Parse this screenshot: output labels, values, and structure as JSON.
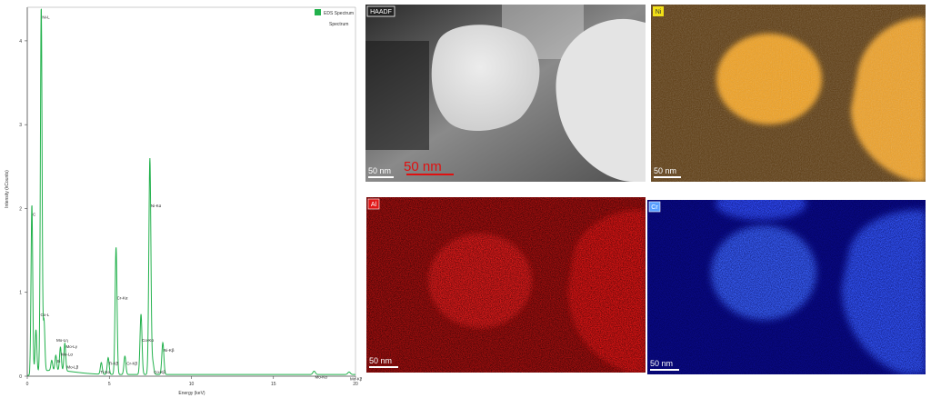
{
  "chart_data": {
    "type": "line",
    "title": "",
    "xlabel": "Energy (keV)",
    "ylabel": "Intensity (kCounts)",
    "xlim": [
      0,
      20
    ],
    "ylim": [
      0,
      4.4
    ],
    "x_ticks": [
      "0",
      "5",
      "10",
      "15",
      "20"
    ],
    "y_ticks": [
      "0",
      "1",
      "2",
      "3",
      "4"
    ],
    "grid": false,
    "legend_position": "top-right",
    "legend": [
      "EDS Spectrum",
      "Spectrum"
    ],
    "series": [
      {
        "name": "EDS Spectrum",
        "color": "#22b14c",
        "peaks": [
          {
            "x": 0.28,
            "y": 2.0
          },
          {
            "x": 0.53,
            "y": 0.5
          },
          {
            "x": 0.85,
            "y": 4.35
          },
          {
            "x": 1.02,
            "y": 0.6
          },
          {
            "x": 1.49,
            "y": 0.12
          },
          {
            "x": 1.74,
            "y": 0.18
          },
          {
            "x": 2.02,
            "y": 0.28
          },
          {
            "x": 2.29,
            "y": 0.33
          },
          {
            "x": 4.51,
            "y": 0.14
          },
          {
            "x": 4.93,
            "y": 0.2
          },
          {
            "x": 5.41,
            "y": 1.52
          },
          {
            "x": 5.95,
            "y": 0.22
          },
          {
            "x": 6.93,
            "y": 0.72
          },
          {
            "x": 7.47,
            "y": 2.58
          },
          {
            "x": 7.65,
            "y": 0.14
          },
          {
            "x": 8.26,
            "y": 0.38
          },
          {
            "x": 17.48,
            "y": 0.04
          },
          {
            "x": 19.61,
            "y": 0.03
          }
        ]
      }
    ],
    "annotations": [
      {
        "text": "Ni-L",
        "x": 0.85,
        "y": 4.35
      },
      {
        "text": "C",
        "x": 0.28,
        "y": 2.0
      },
      {
        "text": "Co-L",
        "x": 0.75,
        "y": 0.8
      },
      {
        "text": "Mo-Lη",
        "x": 1.72,
        "y": 0.5
      },
      {
        "text": "Mo-Lγ",
        "x": 2.3,
        "y": 0.42
      },
      {
        "text": "Mo-Lα",
        "x": 2.0,
        "y": 0.33
      },
      {
        "text": "Mo-Lβ",
        "x": 2.35,
        "y": 0.18
      },
      {
        "text": "Si",
        "x": 1.74,
        "y": 0.25
      },
      {
        "text": "Ti-Kβ",
        "x": 4.9,
        "y": 0.22
      },
      {
        "text": "Ti-Kα",
        "x": 4.4,
        "y": 0.12
      },
      {
        "text": "Cr-Kα",
        "x": 5.41,
        "y": 1.0
      },
      {
        "text": "Cr-Kβ",
        "x": 6.0,
        "y": 0.22
      },
      {
        "text": "Ni-Kα",
        "x": 7.47,
        "y": 2.1
      },
      {
        "text": "Co-Kα",
        "x": 6.93,
        "y": 0.5
      },
      {
        "text": "Co-Kβ",
        "x": 7.65,
        "y": 0.12
      },
      {
        "text": "Ni-Kβ",
        "x": 8.26,
        "y": 0.38
      },
      {
        "text": "Mo-Kα",
        "x": 17.48,
        "y": 0.06
      },
      {
        "text": "Mo-Kβ",
        "x": 19.61,
        "y": 0.04
      }
    ]
  },
  "images": {
    "haadf": {
      "label": "HAADF",
      "scale": "50 nm",
      "overlay": "50 nm"
    },
    "ni": {
      "label": "Ni",
      "scale": "50 nm",
      "color": "#f2a01a"
    },
    "al": {
      "label": "Al",
      "scale": "50 nm",
      "color": "#e81818"
    },
    "cr": {
      "label": "Cr",
      "scale": "50 nm",
      "color": "#2f5cff"
    }
  }
}
